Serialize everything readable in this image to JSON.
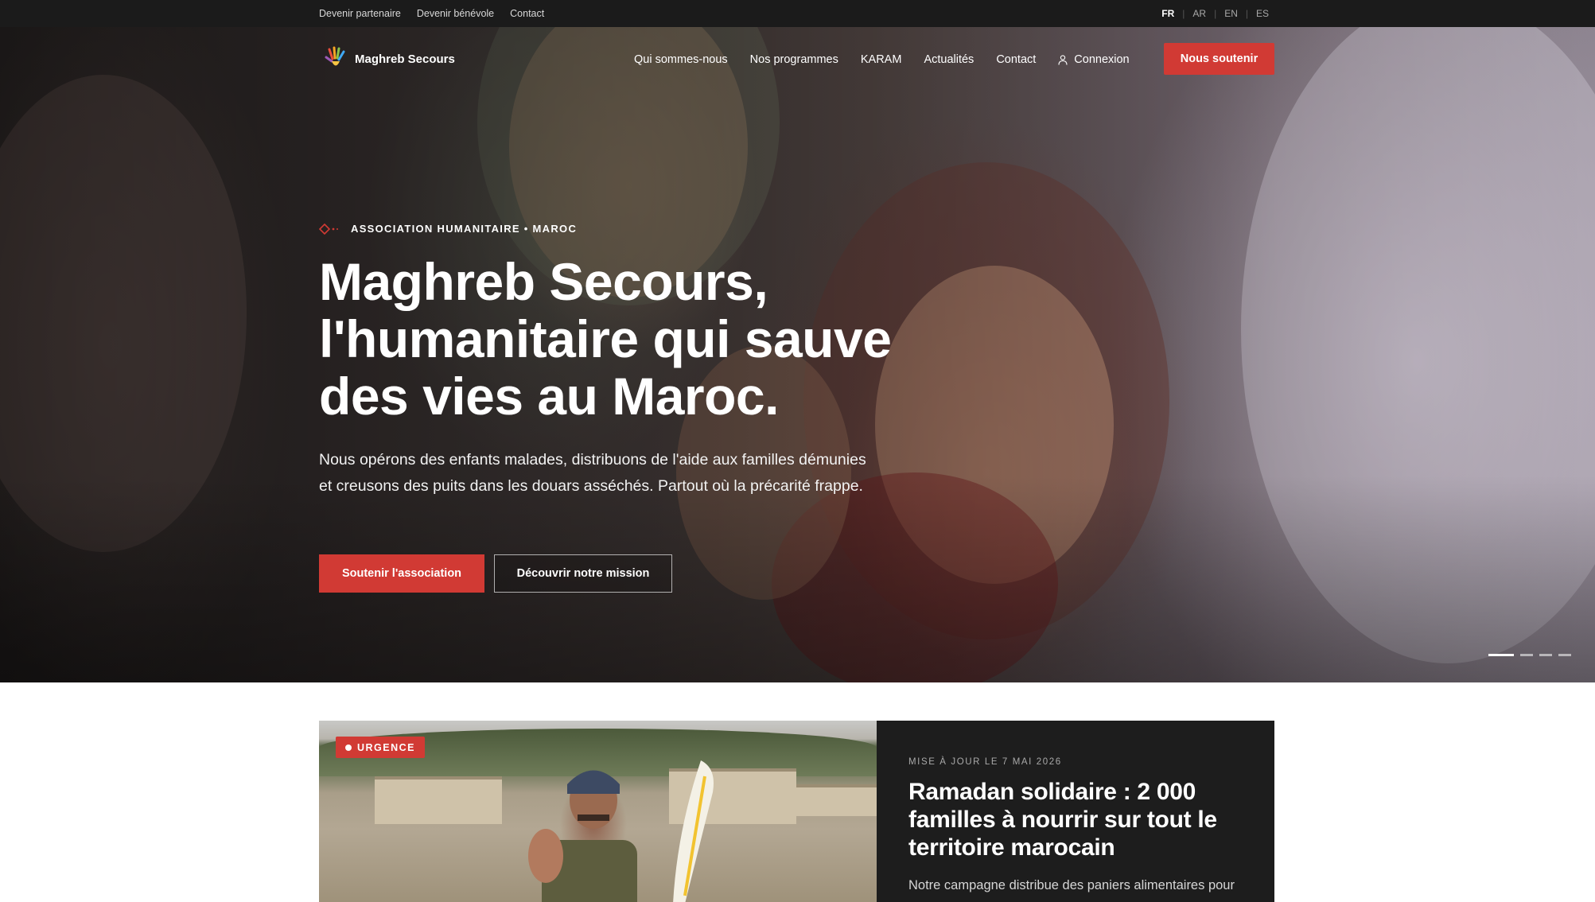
{
  "topbar": {
    "links": [
      "Devenir partenaire",
      "Devenir bénévole",
      "Contact"
    ],
    "languages": [
      "FR",
      "AR",
      "EN",
      "ES"
    ],
    "active_language": "FR"
  },
  "header": {
    "brand": "Maghreb Secours",
    "menu": [
      "Qui sommes-nous",
      "Nos programmes",
      "KARAM",
      "Actualités",
      "Contact"
    ],
    "login_label": "Connexion",
    "support_button": "Nous soutenir"
  },
  "hero": {
    "kicker": "ASSOCIATION HUMANITAIRE • MAROC",
    "title_lines": [
      "Maghreb Secours,",
      "l'humanitaire qui sauve",
      "des vies au Maroc."
    ],
    "lead": "Nous opérons des enfants malades, distribuons de l'aide aux familles démunies et creusons des puits dans les douars asséchés. Partout où la précarité frappe.",
    "primary_cta": "Soutenir l'association",
    "secondary_cta": "Découvrir notre mission",
    "slides_total": 4,
    "active_slide": 1
  },
  "featured": {
    "badge": "URGENCE",
    "meta": "MISE À JOUR LE 7 MAI 2026",
    "title": "Ramadan solidaire : 2 000 familles à nourrir sur tout le territoire marocain",
    "description": "Notre campagne distribue des paniers alimentaires pour"
  },
  "colors": {
    "accent": "#d13a34",
    "topbar_bg": "#1b1b1b",
    "card_bg": "#1d1d1d"
  },
  "icons": {
    "logo": "hand-logo-icon",
    "login": "user-icon",
    "kicker": "diamond-icon",
    "badge": "dot-icon"
  }
}
